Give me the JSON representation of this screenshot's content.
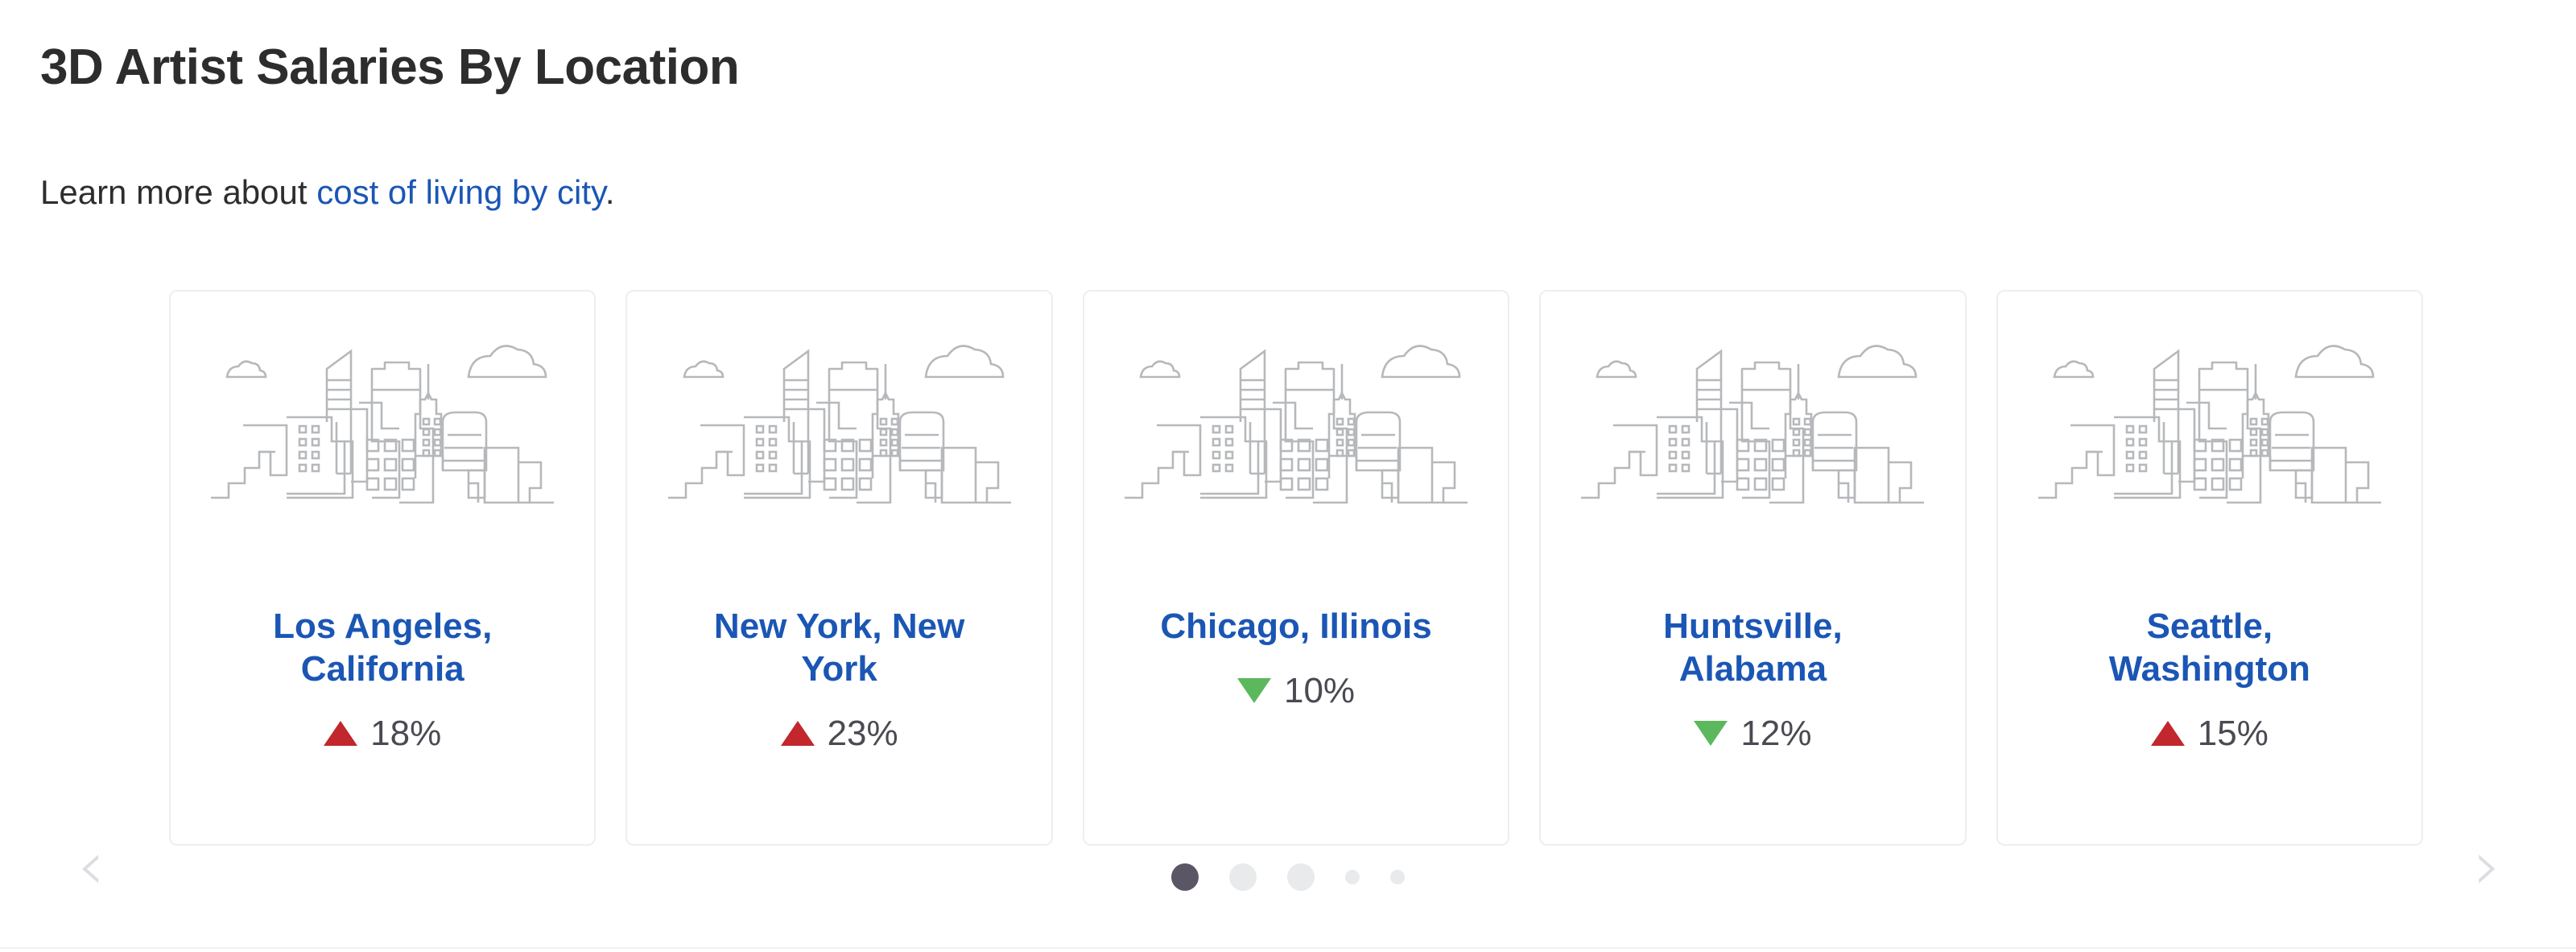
{
  "header": {
    "title": "3D Artist Salaries By Location",
    "subtitle_prefix": "Learn more about ",
    "subtitle_link": "cost of living by city",
    "subtitle_suffix": "."
  },
  "carousel": {
    "prev_label": "‹",
    "next_label": "›",
    "cards": [
      {
        "city": "Los Angeles, California",
        "direction": "up",
        "delta": "18%",
        "skyline_icon": "city-skyline-illustration"
      },
      {
        "city": "New York, New York",
        "direction": "up",
        "delta": "23%",
        "skyline_icon": "city-skyline-illustration"
      },
      {
        "city": "Chicago, Illinois",
        "direction": "down",
        "delta": "10%",
        "skyline_icon": "city-skyline-illustration"
      },
      {
        "city": "Huntsville, Alabama",
        "direction": "down",
        "delta": "12%",
        "skyline_icon": "city-skyline-illustration"
      },
      {
        "city": "Seattle, Washington",
        "direction": "up",
        "delta": "15%",
        "skyline_icon": "city-skyline-illustration"
      }
    ],
    "pagination": {
      "active_index": 0,
      "dots": [
        {
          "size": "lg",
          "state": "active"
        },
        {
          "size": "lg",
          "state": "idle"
        },
        {
          "size": "lg",
          "state": "idle"
        },
        {
          "size": "sm",
          "state": "idle"
        },
        {
          "size": "sm",
          "state": "idle"
        }
      ]
    }
  },
  "colors": {
    "link": "#1b56b5",
    "city_name": "#1b56b5",
    "increase": "#c1272d",
    "decrease": "#5cb85c",
    "text": "#2d2d2d",
    "delta_text": "#4a4a52",
    "card_border": "#eceef0",
    "skyline_stroke": "#b6b8bb",
    "dot_active": "#5b5666",
    "dot_idle": "#e8eaec",
    "arrow": "#dcdce1"
  }
}
